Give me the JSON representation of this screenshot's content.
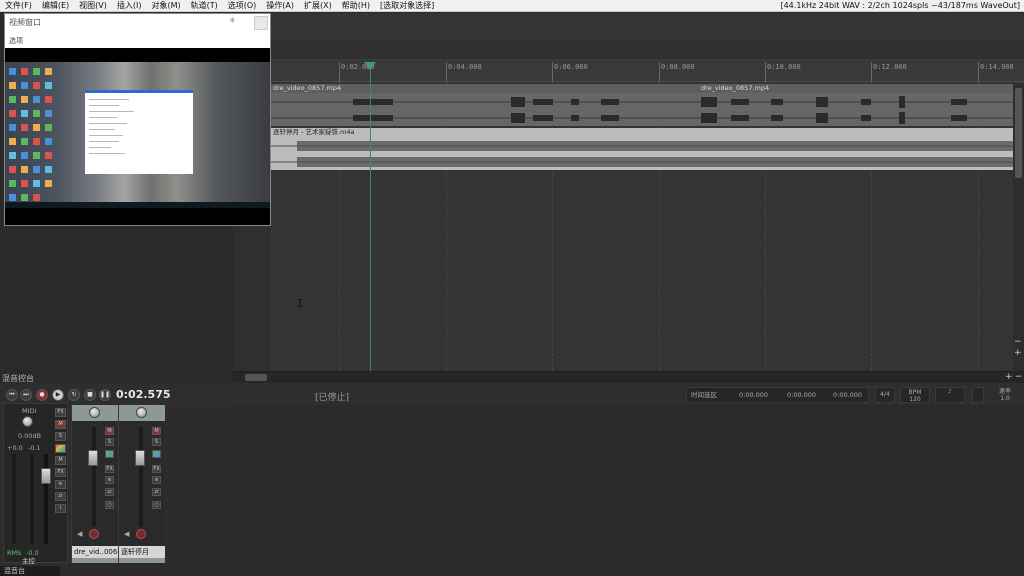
{
  "menu": {
    "items": [
      "文件(F)",
      "编辑(E)",
      "视图(V)",
      "插入(I)",
      "对象(M)",
      "轨道(T)",
      "选项(O)",
      "操作(A)",
      "扩展(X)",
      "帮助(H)",
      "[选取对象选择]"
    ],
    "status": "[44.1kHz 24bit WAV : 2/2ch 1024spls ~43/187ms WaveOut]"
  },
  "ruler": {
    "labels": [
      "0:02.000",
      "0:04.000",
      "0:06.000",
      "0:08.000",
      "0:10.000",
      "0:12.000",
      "0:14.000"
    ]
  },
  "tracks": [
    {
      "item_name": "dre_video_0857.mp4",
      "item_name_2": "dre_video_0857.mp4"
    },
    {
      "item_name": "逐轩停月 - 艺术家疑铁.m4a"
    }
  ],
  "video_window": {
    "title": "视频窗口",
    "options_label": "选项"
  },
  "transport": {
    "time": "0:02.575",
    "state": "[已停止]",
    "selection_label": "时间选区",
    "sel_start": "0:00.000",
    "sel_end": "0:00.000",
    "sel_len": "0:00.000",
    "time_sig": "4/4",
    "bpm_label": "BPM",
    "bpm": "120",
    "rate_label": "速率",
    "rate": "1.0"
  },
  "mixer": {
    "title": "混音控台",
    "master_name": "主控",
    "master_vol": "0.00dB",
    "master_l": "+0.0",
    "master_r": "-0.1",
    "rms_label": "RMS",
    "rms_value": "-0.0",
    "strips": [
      {
        "name": "dre_vid..0068",
        "number": "1"
      },
      {
        "name": "逐轩停月",
        "number": "2"
      }
    ],
    "bottom_tab": "混音台"
  }
}
